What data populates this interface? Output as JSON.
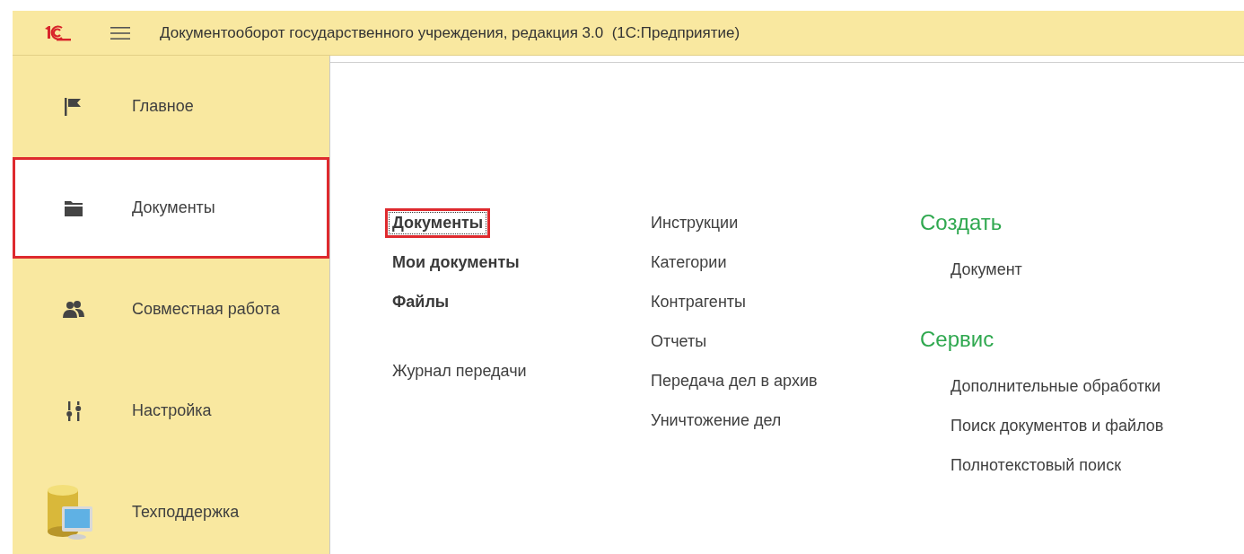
{
  "header": {
    "title": "Документооборот государственного учреждения, редакция 3.0  (1С:Предприятие)"
  },
  "sections": [
    {
      "label": "Главное",
      "kind": "flag",
      "selected": false,
      "highlighted": false
    },
    {
      "label": "Документы",
      "kind": "folder",
      "selected": true,
      "highlighted": true
    },
    {
      "label": "Совместная работа",
      "kind": "people",
      "selected": false,
      "highlighted": false
    },
    {
      "label": "Настройка",
      "kind": "sliders",
      "selected": false,
      "highlighted": false
    },
    {
      "label": "Техподдержка",
      "kind": "support",
      "selected": false,
      "highlighted": false
    }
  ],
  "columns": [
    {
      "groups": [
        {
          "items": [
            {
              "label": "Документы",
              "bold": true,
              "selected": true,
              "highlighted": true
            },
            {
              "label": "Мои документы",
              "bold": true,
              "selected": false,
              "highlighted": false
            },
            {
              "label": "Файлы",
              "bold": true,
              "selected": false,
              "highlighted": false
            }
          ]
        },
        {
          "items": [
            {
              "label": "Журнал передачи",
              "bold": false,
              "selected": false,
              "highlighted": false
            }
          ]
        }
      ]
    },
    {
      "groups": [
        {
          "items": [
            {
              "label": "Инструкции",
              "bold": false,
              "selected": false,
              "highlighted": false
            },
            {
              "label": "Категории",
              "bold": false,
              "selected": false,
              "highlighted": false
            },
            {
              "label": "Контрагенты",
              "bold": false,
              "selected": false,
              "highlighted": false
            },
            {
              "label": "Отчеты",
              "bold": false,
              "selected": false,
              "highlighted": false
            },
            {
              "label": "Передача дел в архив",
              "bold": false,
              "selected": false,
              "highlighted": false
            },
            {
              "label": "Уничтожение дел",
              "bold": false,
              "selected": false,
              "highlighted": false
            }
          ]
        }
      ]
    },
    {
      "groups": [
        {
          "heading": "Создать",
          "items": [
            {
              "label": "Документ",
              "bold": false,
              "selected": false,
              "highlighted": false
            }
          ]
        },
        {
          "heading": "Сервис",
          "items": [
            {
              "label": "Дополнительные обработки",
              "bold": false,
              "selected": false,
              "highlighted": false
            },
            {
              "label": "Поиск документов и файлов",
              "bold": false,
              "selected": false,
              "highlighted": false
            },
            {
              "label": "Полнотекстовый поиск",
              "bold": false,
              "selected": false,
              "highlighted": false
            }
          ]
        }
      ]
    }
  ]
}
